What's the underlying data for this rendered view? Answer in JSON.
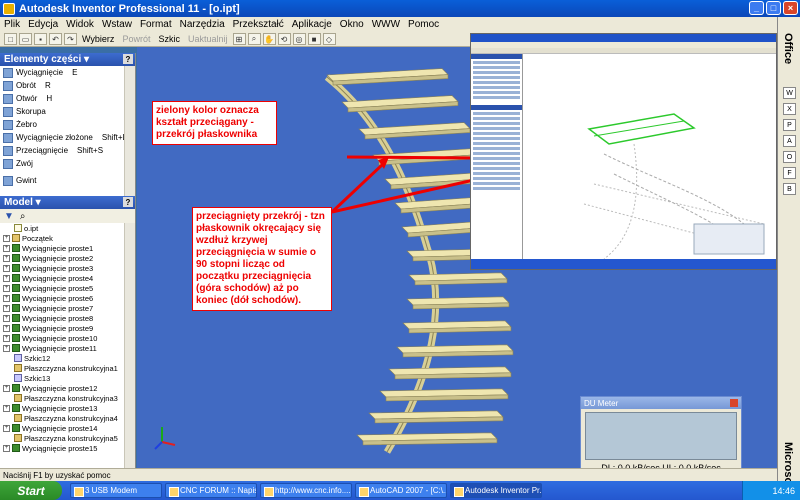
{
  "window": {
    "title": "Autodesk Inventor Professional 11 - [o.ipt]"
  },
  "menu": [
    "Plik",
    "Edycja",
    "Widok",
    "Wstaw",
    "Format",
    "Narzędzia",
    "Przekształć",
    "Aplikacje",
    "Okno",
    "WWW",
    "Pomoc"
  ],
  "toolbar": {
    "select_label": "Wybierz",
    "return_label": "Powrót",
    "sketch_label": "Szkic",
    "update_label": "Uaktualnij"
  },
  "features_panel": {
    "title": "Elementy części",
    "items": [
      {
        "label": "Wyciągnięcie",
        "key": "E"
      },
      {
        "label": "Obrót",
        "key": "R"
      },
      {
        "label": "Otwór",
        "key": "H"
      },
      {
        "label": "Skorupa",
        "key": ""
      },
      {
        "label": "Żebro",
        "key": ""
      },
      {
        "label": "Wyciągnięcie złożone",
        "key": "Shift+L"
      },
      {
        "label": "Przeciągnięcie",
        "key": "Shift+S"
      },
      {
        "label": "Zwój",
        "key": ""
      },
      {
        "label": "Gwint",
        "key": ""
      }
    ]
  },
  "model_panel": {
    "title": "Model",
    "tree": [
      {
        "label": "o.ipt",
        "type": "doc"
      },
      {
        "label": "Początek",
        "type": "plane"
      },
      {
        "label": "Wyciągnięcie proste1",
        "type": "feature"
      },
      {
        "label": "Wyciągnięcie proste2",
        "type": "feature"
      },
      {
        "label": "Wyciągnięcie proste3",
        "type": "feature"
      },
      {
        "label": "Wyciągnięcie proste4",
        "type": "feature"
      },
      {
        "label": "Wyciągnięcie proste5",
        "type": "feature"
      },
      {
        "label": "Wyciągnięcie proste6",
        "type": "feature"
      },
      {
        "label": "Wyciągnięcie proste7",
        "type": "feature"
      },
      {
        "label": "Wyciągnięcie proste8",
        "type": "feature"
      },
      {
        "label": "Wyciągnięcie proste9",
        "type": "feature"
      },
      {
        "label": "Wyciągnięcie proste10",
        "type": "feature"
      },
      {
        "label": "Wyciągnięcie proste11",
        "type": "feature"
      },
      {
        "label": "Szkic12",
        "type": "sketch"
      },
      {
        "label": "Płaszczyzna konstrukcyjna1",
        "type": "plane"
      },
      {
        "label": "Szkic13",
        "type": "sketch"
      },
      {
        "label": "Wyciągnięcie proste12",
        "type": "feature"
      },
      {
        "label": "Płaszczyzna konstrukcyjna3",
        "type": "plane"
      },
      {
        "label": "Wyciągnięcie proste13",
        "type": "feature"
      },
      {
        "label": "Płaszczyzna konstrukcyjna4",
        "type": "plane"
      },
      {
        "label": "Wyciągnięcie proste14",
        "type": "feature"
      },
      {
        "label": "Płaszczyzna konstrukcyjna5",
        "type": "plane"
      },
      {
        "label": "Wyciągnięcie proste15",
        "type": "feature"
      }
    ]
  },
  "annotations": {
    "top": "zielony kolor oznacza kształt przeciągany - przekrój płaskownika",
    "bottom": "przeciągnięty przekrój - tzn płaskownik okręcający się wzdłuż krzywej przeciągnięcia w sumie o 90 stopni licząc od początku przeciągnięcia (góra schodów) aż po koniec (dół schodów)."
  },
  "dd_meter": {
    "title": "DU Meter",
    "readout": "DL: 0,0 kB/sec   UL: 0,0 kB/sec"
  },
  "status": "Naciśnij F1 by uzyskać pomoc",
  "office_bar": {
    "label": "Office",
    "label2": "Microsoft"
  },
  "taskbar": {
    "start": "Start",
    "tasks": [
      "3 USB Modem",
      "CNC FORUM :: Napis...",
      "http://www.cnc.info....",
      "AutoCAD 2007 - [C:\\...",
      "Autodesk Inventor Pr..."
    ],
    "clock": "14:46"
  },
  "colors": {
    "viewport": "#416ac2",
    "stair": "#efe6b0",
    "callout_text": "#e00000",
    "title_bar": "#0b47b8"
  }
}
